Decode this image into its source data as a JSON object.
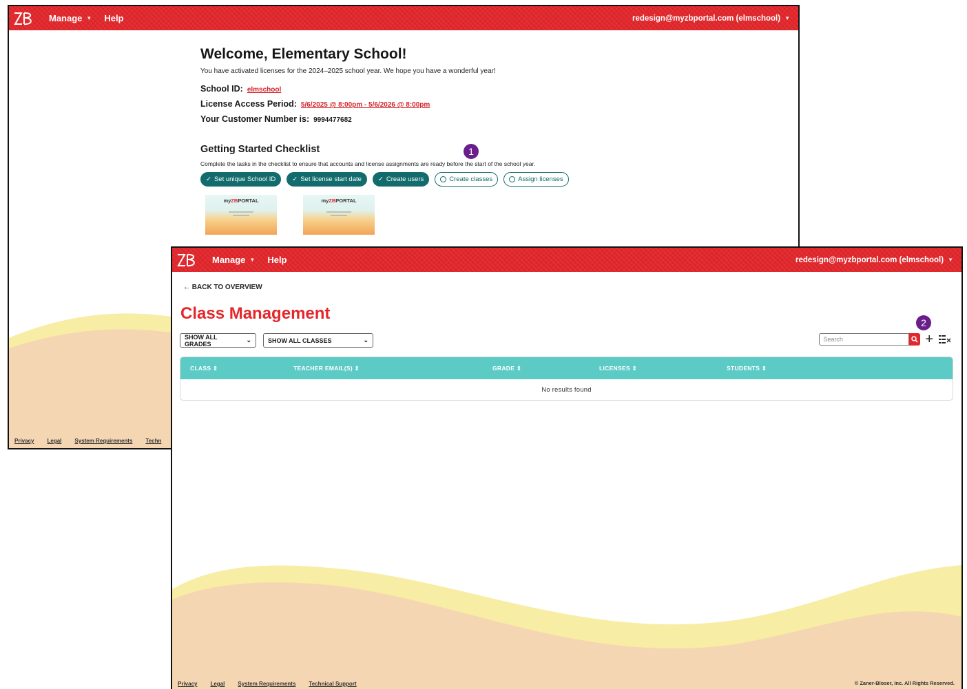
{
  "theme": {
    "brand_red": "#e3272c",
    "teal_dark": "#126b6c",
    "teal_header": "#5ccac5",
    "badge_purple": "#6a1e8c",
    "wave_yellow": "#f8eda4",
    "wave_peach": "#f5d6b3"
  },
  "nav": {
    "logo_icon": "zb-logo-icon",
    "manage_label": "Manage",
    "help_label": "Help",
    "user_label": "redesign@myzbportal.com (elmschool)"
  },
  "overview": {
    "title": "Welcome, Elementary School!",
    "intro": "You have activated licenses for the 2024–2025 school year. We hope you have a wonderful year!",
    "school_id_label": "School ID:",
    "school_id_value": "elmschool",
    "license_label": "License Access Period:",
    "license_value": "5/6/2025 @ 8:00pm - 5/6/2026 @ 8:00pm",
    "customer_label": "Your Customer Number is:",
    "customer_value": "9994477682",
    "checklist_title": "Getting Started Checklist",
    "checklist_text": "Complete the tasks in the checklist to ensure that accounts and license assignments are ready before the start of the school year.",
    "checklist": [
      {
        "label": "Set unique School ID",
        "done": true
      },
      {
        "label": "Set license start date",
        "done": true
      },
      {
        "label": "Create users",
        "done": true
      },
      {
        "label": "Create classes",
        "done": false
      },
      {
        "label": "Assign licenses",
        "done": false
      }
    ],
    "thumb_brand_prefix": "my",
    "thumb_brand_zb": "ZB",
    "thumb_brand_suffix": "PORTAL",
    "badge": "1",
    "footer": [
      "Privacy",
      "Legal",
      "System Requirements",
      "Techn"
    ]
  },
  "classes": {
    "back_label": "← BACK TO OVERVIEW",
    "title": "Class Management",
    "grade_filter": "SHOW ALL GRADES",
    "class_filter": "SHOW ALL CLASSES",
    "search_placeholder": "Search",
    "badge": "2",
    "columns": [
      "CLASS ⇕",
      "TEACHER EMAIL(S) ⇕",
      "GRADE ⇕",
      "LICENSES ⇕",
      "STUDENTS ⇕"
    ],
    "empty_text": "No results found",
    "footer": [
      "Privacy",
      "Legal",
      "System Requirements",
      "Technical Support"
    ],
    "copyright": "© Zaner-Bloser, Inc. All Rights Reserved."
  }
}
